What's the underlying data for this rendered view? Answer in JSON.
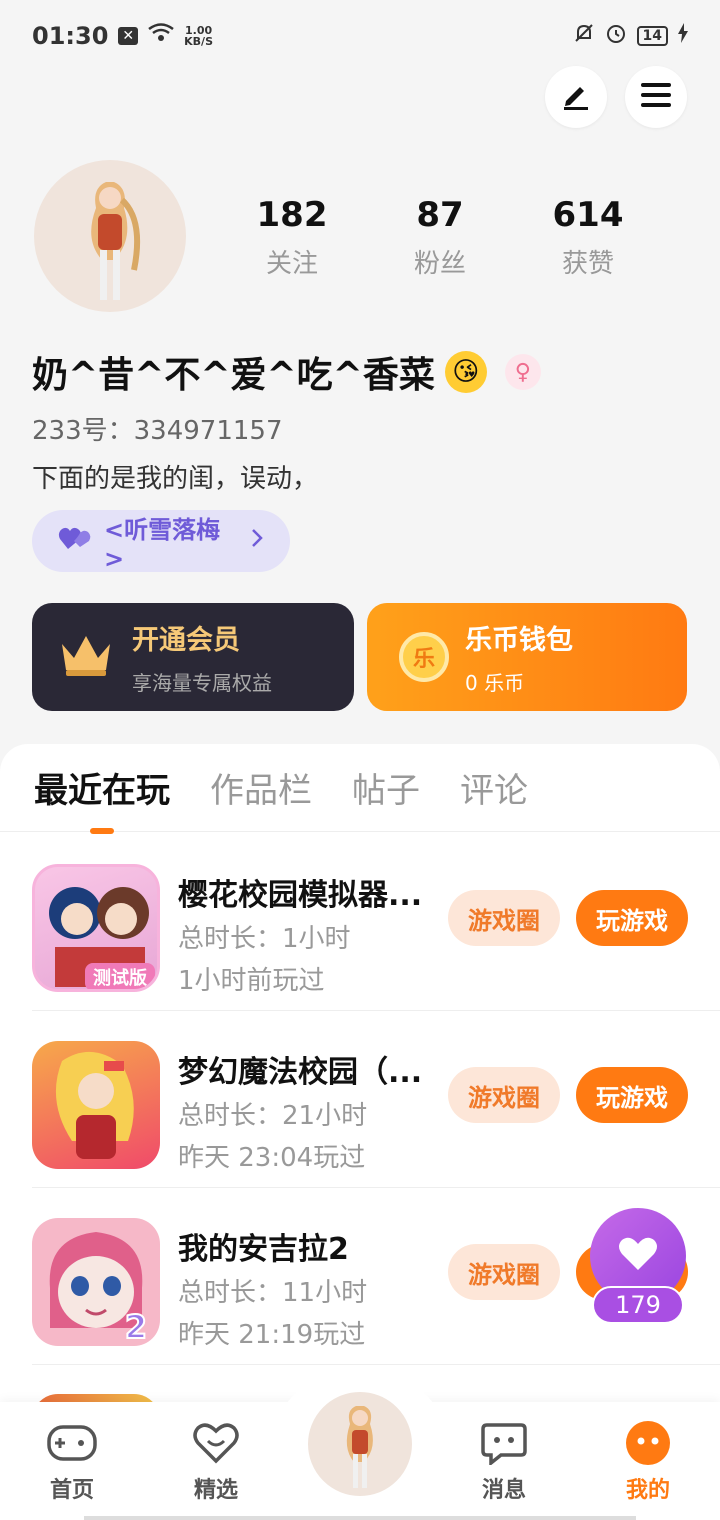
{
  "status_bar": {
    "time": "01:30",
    "net_speed_value": "1.00",
    "net_speed_unit": "KB/S",
    "battery": "14"
  },
  "profile": {
    "stats": [
      {
        "value": "182",
        "label": "关注"
      },
      {
        "value": "87",
        "label": "粉丝"
      },
      {
        "value": "614",
        "label": "获赞"
      }
    ],
    "nickname": "奶^昔^不^爱^吃^香菜",
    "emoji": "😘",
    "gender_symbol": "♀",
    "uid": "233号：334971157",
    "bio": "下面的是我的闺，误动，",
    "cp_label": "<听雪落梅>"
  },
  "cards": {
    "vip_title": "开通会员",
    "vip_sub": "享海量专属权益",
    "wallet_title": "乐币钱包",
    "wallet_sub": "0 乐币",
    "coin_char": "乐"
  },
  "tabs": [
    "最近在玩",
    "作品栏",
    "帖子",
    "评论"
  ],
  "games": [
    {
      "name": "樱花校园模拟器...",
      "duration": "总时长：1小时",
      "last": "1小时前玩过",
      "circle": "游戏圈",
      "play": "玩游戏",
      "badge": "测试版"
    },
    {
      "name": "梦幻魔法校园（...",
      "duration": "总时长：21小时",
      "last": "昨天 23:04玩过",
      "circle": "游戏圈",
      "play": "玩游戏"
    },
    {
      "name": "我的安吉拉2",
      "duration": "总时长：11小时",
      "last": "昨天 21:19玩过",
      "circle": "游戏圈",
      "badge": "2"
    }
  ],
  "like_count": "179",
  "bottom_nav": [
    "首页",
    "精选",
    "消息",
    "我的"
  ],
  "colors": {
    "accent": "#ff7a12",
    "purple": "#a94fe3"
  }
}
